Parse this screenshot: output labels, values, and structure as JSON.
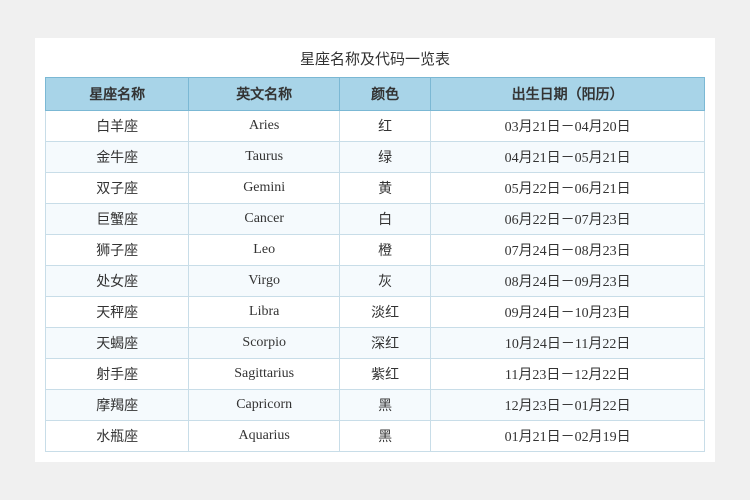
{
  "title": "星座名称及代码一览表",
  "table": {
    "headers": [
      "星座名称",
      "英文名称",
      "颜色",
      "出生日期（阳历）"
    ],
    "rows": [
      {
        "chinese": "白羊座",
        "english": "Aries",
        "color": "红",
        "dates": "03月21日－04月20日"
      },
      {
        "chinese": "金牛座",
        "english": "Taurus",
        "color": "绿",
        "dates": "04月21日－05月21日"
      },
      {
        "chinese": "双子座",
        "english": "Gemini",
        "color": "黄",
        "dates": "05月22日－06月21日"
      },
      {
        "chinese": "巨蟹座",
        "english": "Cancer",
        "color": "白",
        "dates": "06月22日－07月23日"
      },
      {
        "chinese": "狮子座",
        "english": "Leo",
        "color": "橙",
        "dates": "07月24日－08月23日"
      },
      {
        "chinese": "处女座",
        "english": "Virgo",
        "color": "灰",
        "dates": "08月24日－09月23日"
      },
      {
        "chinese": "天秤座",
        "english": "Libra",
        "color": "淡红",
        "dates": "09月24日－10月23日"
      },
      {
        "chinese": "天蝎座",
        "english": "Scorpio",
        "color": "深红",
        "dates": "10月24日－11月22日"
      },
      {
        "chinese": "射手座",
        "english": "Sagittarius",
        "color": "紫红",
        "dates": "11月23日－12月22日"
      },
      {
        "chinese": "摩羯座",
        "english": "Capricorn",
        "color": "黑",
        "dates": "12月23日－01月22日"
      },
      {
        "chinese": "水瓶座",
        "english": "Aquarius",
        "color": "黑",
        "dates": "01月21日－02月19日"
      }
    ]
  }
}
